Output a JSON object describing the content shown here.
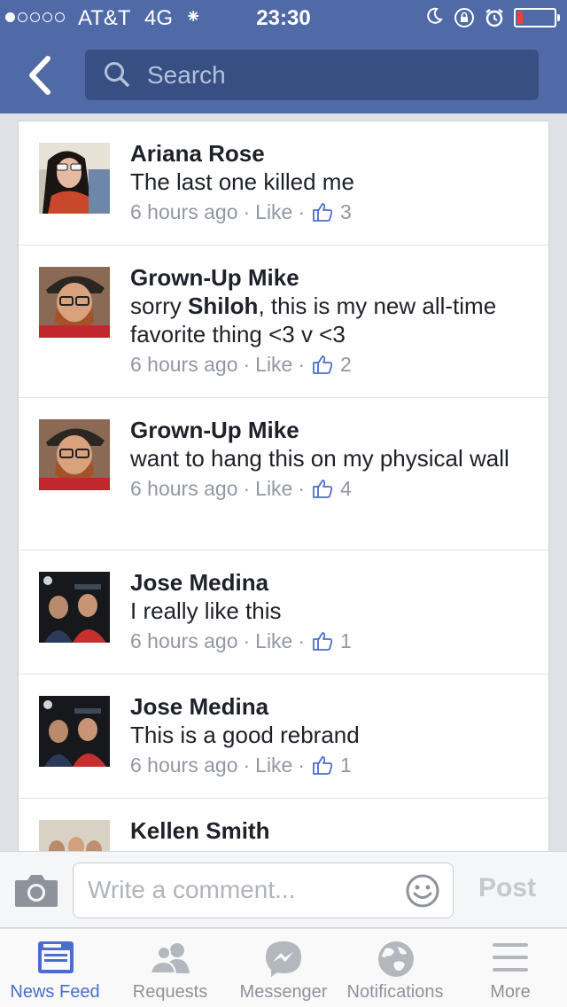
{
  "status_bar": {
    "carrier": "AT&T",
    "network": "4G",
    "time": "23:30",
    "signal_bars_filled": 1,
    "signal_bars_total": 5,
    "battery_level": 0.15
  },
  "nav": {
    "back_icon": "chevron-left-icon",
    "search_placeholder": "Search"
  },
  "comments": [
    {
      "author": "Ariana Rose",
      "text": "The last one killed me",
      "time": "6 hours ago",
      "like_label": "Like",
      "likes": "3",
      "avatar": "ariana"
    },
    {
      "author": "Grown-Up Mike",
      "text_prefix": "sorry ",
      "mention": "Shiloh",
      "text_suffix": ", this is my new all-time favorite thing  <3 v <3",
      "time": "6 hours ago",
      "like_label": "Like",
      "likes": "2",
      "avatar": "mike"
    },
    {
      "author": "Grown-Up Mike",
      "text": "want to hang this on my physical wall",
      "time": "6 hours ago",
      "like_label": "Like",
      "likes": "4",
      "avatar": "mike"
    },
    {
      "author": "Jose Medina",
      "text": "I really like this",
      "time": "6 hours ago",
      "like_label": "Like",
      "likes": "1",
      "avatar": "jose"
    },
    {
      "author": "Jose Medina",
      "text": "This is a good rebrand",
      "time": "6 hours ago",
      "like_label": "Like",
      "likes": "1",
      "avatar": "jose"
    },
    {
      "author": "Kellen Smith",
      "avatar": "kellen"
    }
  ],
  "composer": {
    "placeholder": "Write a comment...",
    "post_label": "Post"
  },
  "tabs": [
    {
      "label": "News Feed",
      "icon": "news-feed-icon",
      "active": true
    },
    {
      "label": "Requests",
      "icon": "friend-requests-icon",
      "active": false
    },
    {
      "label": "Messenger",
      "icon": "messenger-icon",
      "active": false
    },
    {
      "label": "Notifications",
      "icon": "globe-icon",
      "active": false
    },
    {
      "label": "More",
      "icon": "menu-icon",
      "active": false
    }
  ],
  "colors": {
    "brand_blue": "#4f6aa6",
    "active_tab": "#4b6dcc",
    "meta_gray": "#9197a3"
  }
}
